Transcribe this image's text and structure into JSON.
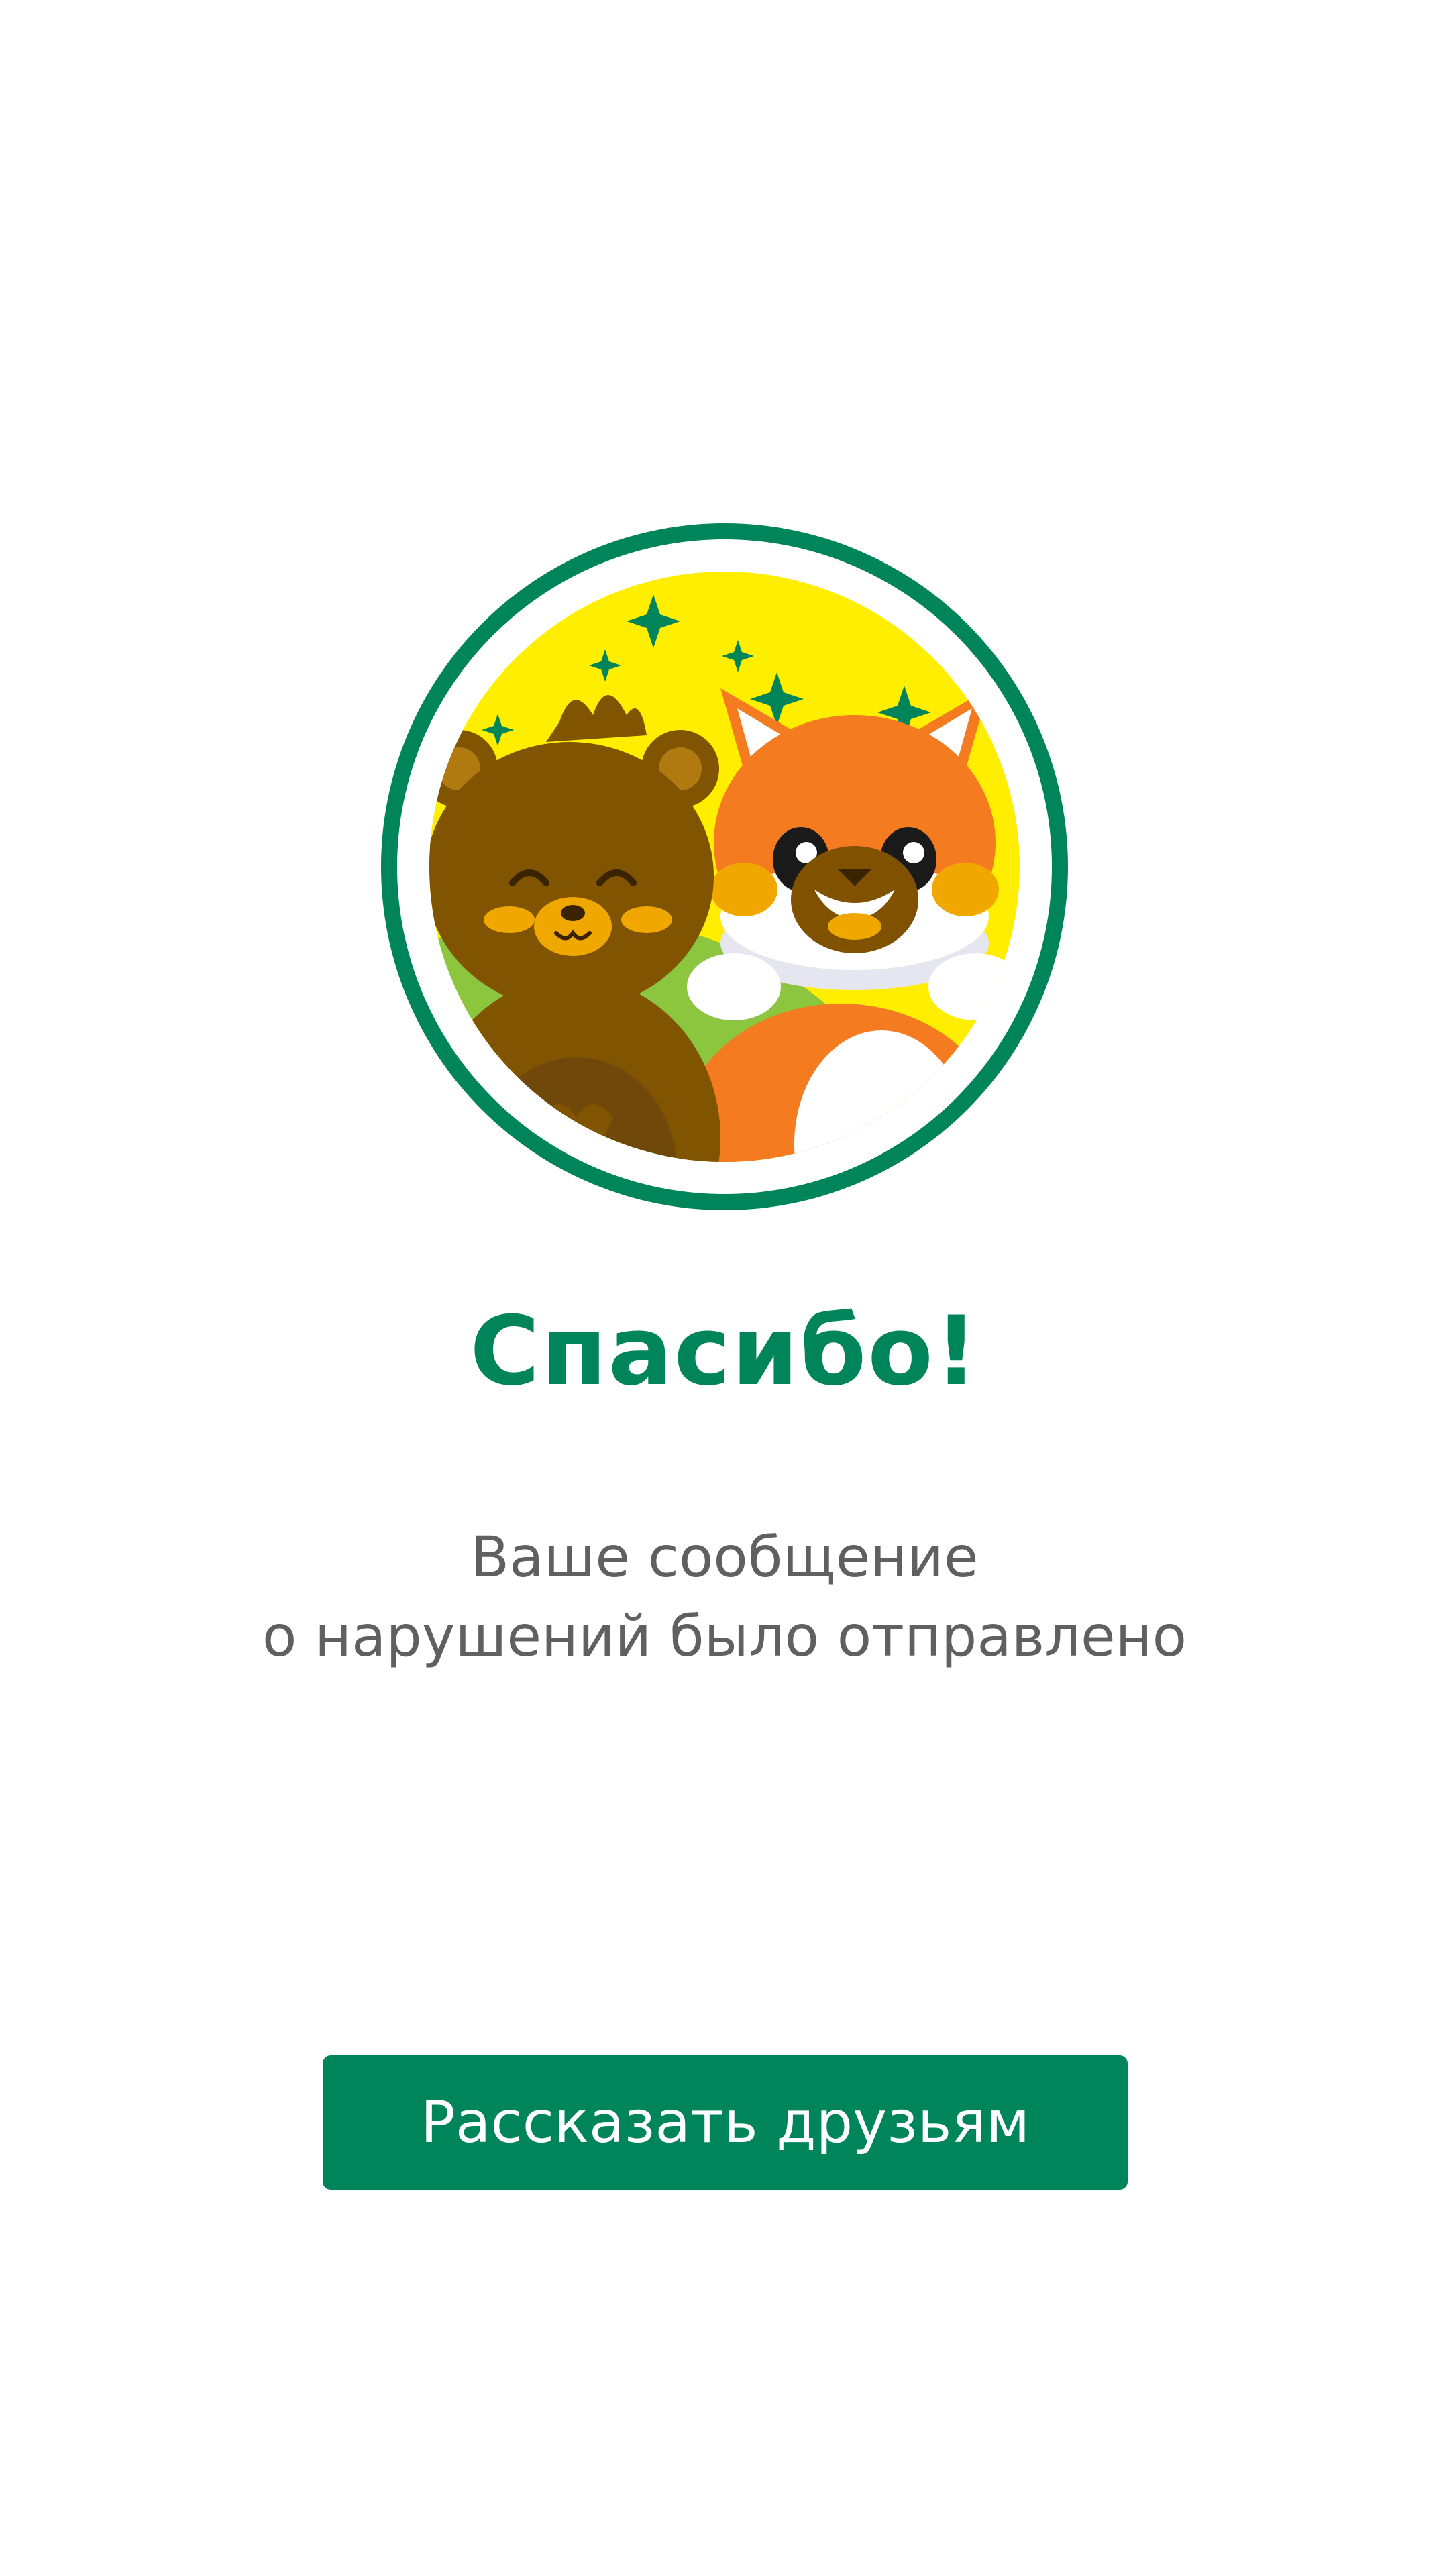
{
  "illustration": {
    "name": "bear-and-fox-mascots-illustration",
    "ring_color": "#00855a",
    "sky_color": "#ffee00"
  },
  "confirmation": {
    "title": "Спасибо!",
    "message_line_1": "Ваше сообщение",
    "message_line_2": "о нарушений было отправлено"
  },
  "actions": {
    "share_label": "Рассказать друзьям"
  },
  "colors": {
    "accent": "#00855a",
    "text_secondary": "#606060",
    "background": "#ffffff"
  }
}
